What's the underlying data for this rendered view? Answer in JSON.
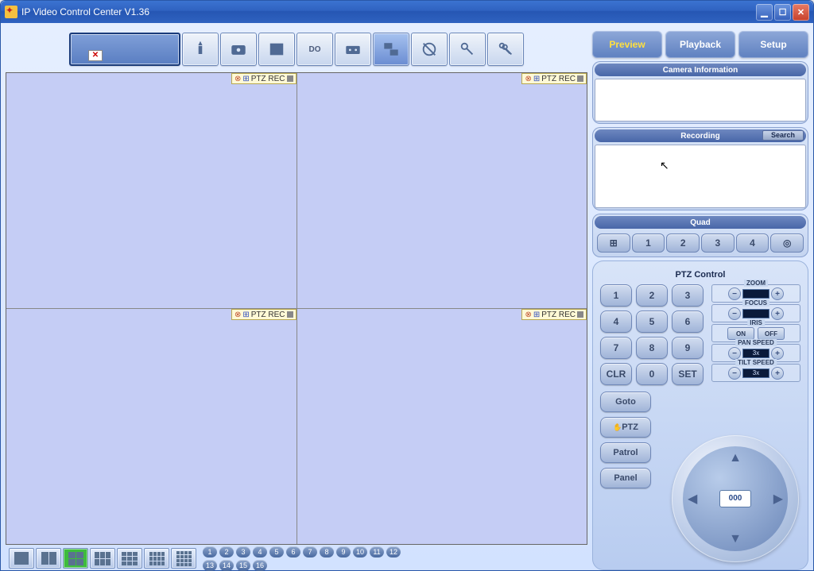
{
  "window": {
    "title": "IP Video Control Center V1.36"
  },
  "toolbar": {
    "buttons": [
      "main",
      "tool",
      "camera",
      "expand",
      "do",
      "tape",
      "quad",
      "globe",
      "key",
      "keys"
    ]
  },
  "tabs": {
    "preview": "Preview",
    "playback": "Playback",
    "setup": "Setup"
  },
  "camInfo": {
    "title": "Camera Information"
  },
  "recording": {
    "title": "Recording",
    "search": "Search"
  },
  "quad": {
    "title": "Quad",
    "items": [
      "",
      "1",
      "2",
      "3",
      "4",
      ""
    ]
  },
  "ptz": {
    "title": "PTZ Control",
    "keys": [
      "1",
      "2",
      "3",
      "4",
      "5",
      "6",
      "7",
      "8",
      "9",
      "CLR",
      "0",
      "SET"
    ],
    "goto": "Goto",
    "ptz": "PTZ",
    "patrol": "Patrol",
    "panel": "Panel",
    "zoom": "ZOOM",
    "focus": "FOCUS",
    "iris": "IRIS",
    "iris_on": "ON",
    "iris_off": "OFF",
    "pan": "PAN SPEED",
    "pan_v": "3x",
    "tilt": "TILT SPEED",
    "tilt_v": "3x",
    "center": "000"
  },
  "pane": {
    "label": "PTZ REC"
  },
  "bottom": {
    "numbers": [
      "1",
      "2",
      "3",
      "4",
      "5",
      "6",
      "7",
      "8",
      "9",
      "10",
      "11",
      "12",
      "13",
      "14",
      "15",
      "16"
    ]
  },
  "layouts": [
    [
      1,
      1
    ],
    [
      1,
      2
    ],
    [
      2,
      2
    ],
    [
      2,
      3
    ],
    [
      3,
      3
    ],
    [
      3,
      4
    ],
    [
      4,
      4
    ]
  ]
}
